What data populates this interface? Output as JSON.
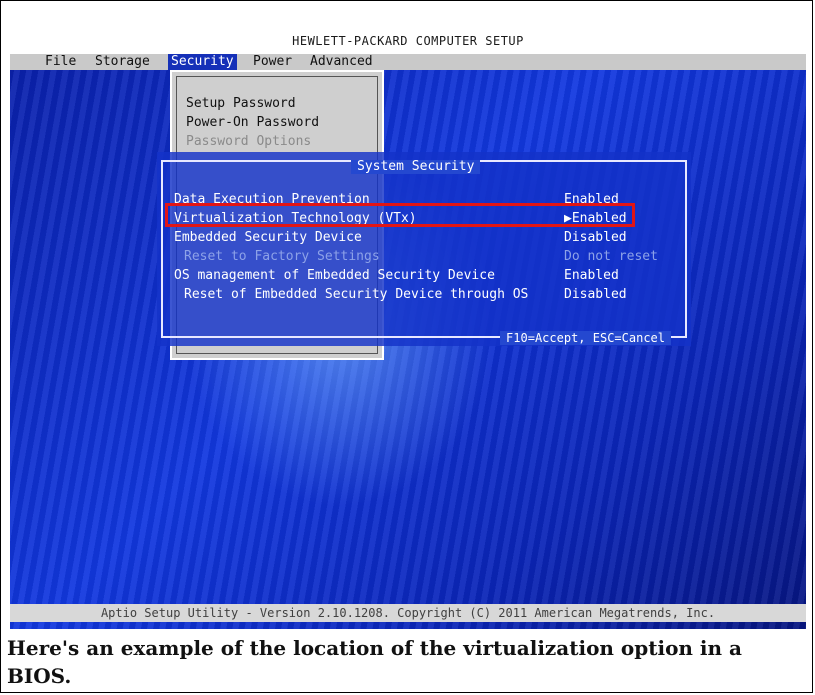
{
  "bios": {
    "title": "HEWLETT-PACKARD COMPUTER SETUP",
    "menu": [
      {
        "label": "File"
      },
      {
        "label": "Storage"
      },
      {
        "label": "Security"
      },
      {
        "label": "Power"
      },
      {
        "label": "Advanced"
      }
    ],
    "security_menu": [
      {
        "label": "Setup Password"
      },
      {
        "label": "Power-On Password"
      },
      {
        "label": "Password Options"
      }
    ],
    "dialog": {
      "title": "System Security",
      "footer": "F10=Accept, ESC=Cancel",
      "rows": [
        {
          "label": "Data Execution Prevention",
          "value": "Enabled"
        },
        {
          "label": "Virtualization Technology (VTx)",
          "value": "▶Enabled"
        },
        {
          "label": "Embedded Security Device",
          "value": "Disabled"
        },
        {
          "label": "Reset to Factory Settings",
          "value": "Do not reset"
        },
        {
          "label": "OS management of Embedded Security Device",
          "value": "Enabled"
        },
        {
          "label": "Reset of Embedded Security Device through OS",
          "value": "Disabled"
        }
      ]
    },
    "status_bar": "Aptio Setup Utility - Version 2.10.1208. Copyright (C) 2011 American Megatrends, Inc."
  },
  "caption": "Here's an example of the location of the virtualization option in a BIOS.",
  "colors": {
    "highlight": "#e21515",
    "background": "#1238e0"
  }
}
